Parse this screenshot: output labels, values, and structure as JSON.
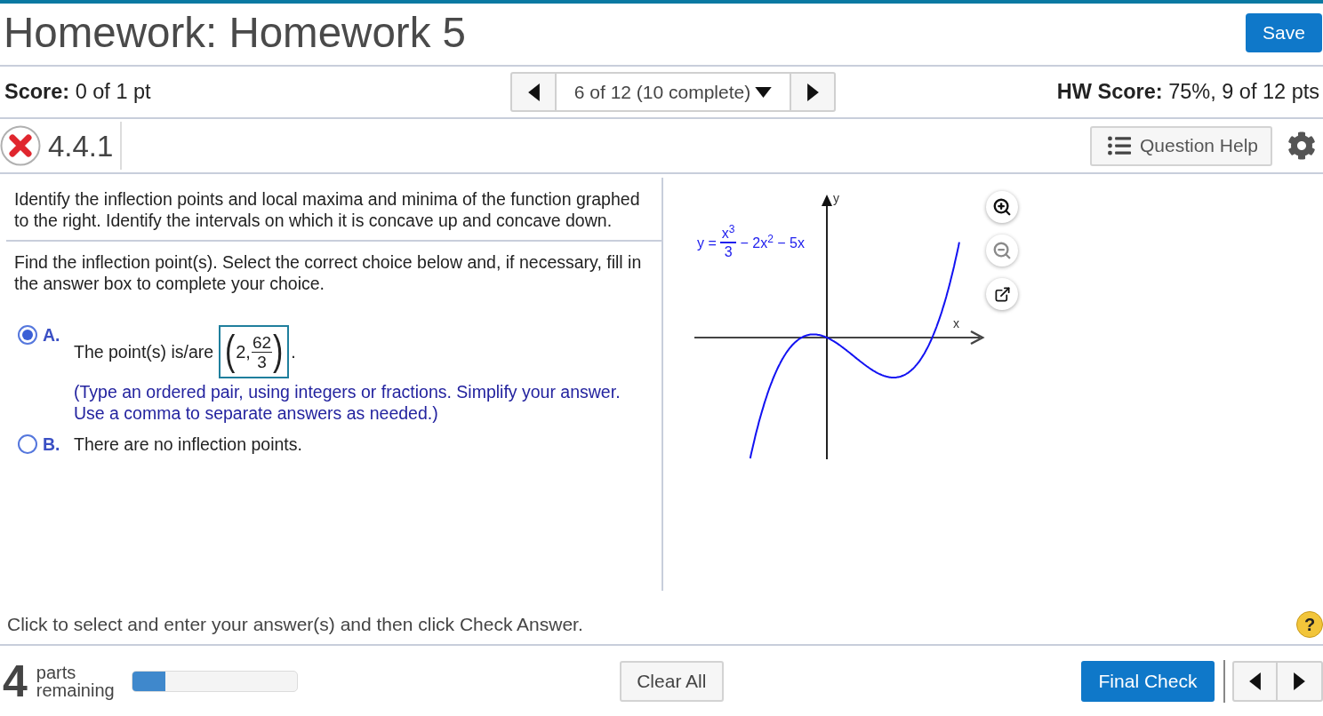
{
  "header": {
    "title": "Homework: Homework 5",
    "save_button": "Save"
  },
  "score_bar": {
    "score": "**Score:** 0 of 1 pt",
    "navigator": "6 of 12 (10 complete)",
    "hw_score": "**HW Score:** 75%, 9 of 12 pts"
  },
  "question_bar": {
    "incorrect": true,
    "number": "4.4.1",
    "help_button": "Question Help"
  },
  "question": {
    "prompt": "Identify the inflection points and local maxima and minima of the function graphed to the right. Identify the intervals on which it is concave up and concave down.",
    "part_prompt": "Find the inflection point(s). Select the correct choice below and, if necessary, fill in the answer box to complete your choice.",
    "choices": [
      {
        "letter": "A.",
        "kind": "answer",
        "selected": true,
        "text": "The point(s) is/are",
        "answer": {
          "open": "(",
          "first": "2,",
          "numerator": "62",
          "denominator": "3",
          "close": ")"
        },
        "after": ".",
        "hint": "(Type an ordered pair, using integers or fractions. Simplify your answer. Use a comma to separate answers as needed.)"
      },
      {
        "letter": "B.",
        "kind": "plain",
        "selected": false,
        "text": "There are no inflection points."
      }
    ]
  },
  "graph": {
    "equation": {
      "lhs": "y =",
      "numerator": "x$^{3}$",
      "denominator": "3",
      "rest": "− 2x$^{2}$ − 5x"
    },
    "axis_labels": {
      "x": "x",
      "y": "y"
    }
  },
  "instruction": "Click to select and enter your answer(s) and then click Check Answer.",
  "help_mark": "?",
  "footer": {
    "parts_count": "4",
    "parts_label": "parts remaining",
    "progress": {
      "level": 0.2
    },
    "clear_button": "Clear All",
    "check_button": "Final Check"
  }
}
